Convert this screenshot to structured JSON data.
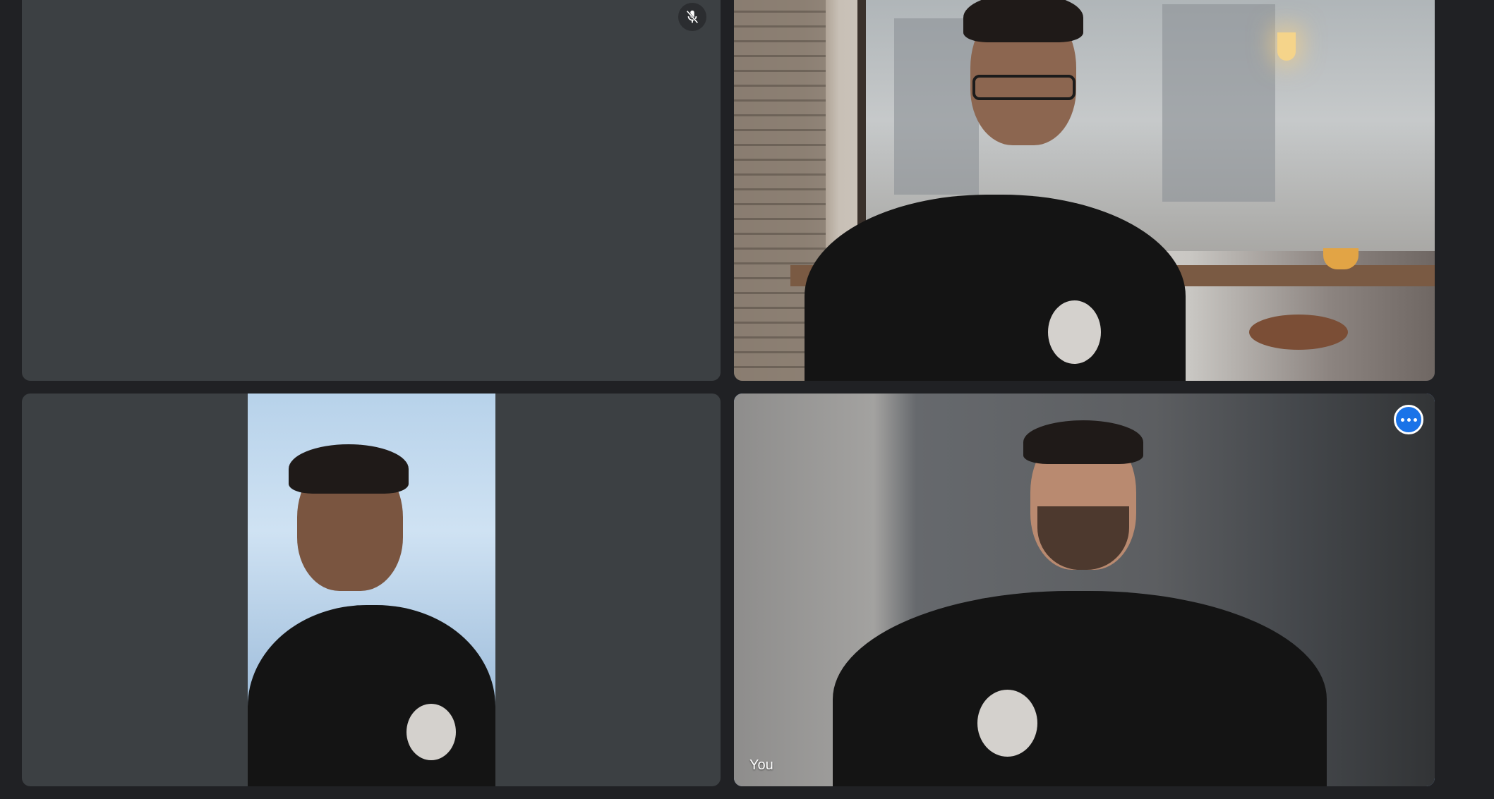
{
  "participants": [
    {
      "id": "p1",
      "name": "",
      "muted": true,
      "icon": "mic-off-icon",
      "video": false
    },
    {
      "id": "p2",
      "name": "",
      "muted": false,
      "video": true,
      "background": "cafe-window"
    },
    {
      "id": "p3",
      "name": "",
      "muted": false,
      "video": true,
      "orientation": "portrait"
    },
    {
      "id": "p4",
      "name": "You",
      "muted": false,
      "video": true,
      "active_speaker": true,
      "menu_icon": "more-options-icon"
    }
  ],
  "colors": {
    "page_background": "#202124",
    "tile_background": "#3c4043",
    "active_border": "#8ab4f8",
    "menu_button": "#1a73e8"
  }
}
